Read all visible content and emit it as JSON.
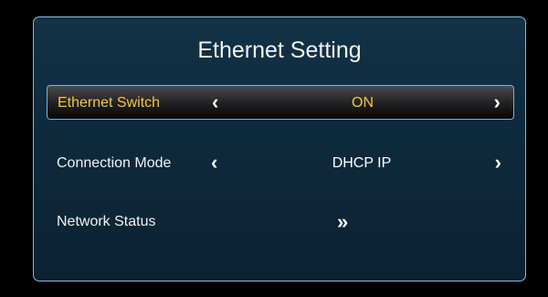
{
  "title": "Ethernet Setting",
  "rows": [
    {
      "label": "Ethernet Switch",
      "value": "ON",
      "selected": true
    },
    {
      "label": "Connection Mode",
      "value": "DHCP IP",
      "selected": false
    },
    {
      "label": "Network Status",
      "action": "enter",
      "selected": false
    }
  ],
  "icons": {
    "left": "‹",
    "right": "›",
    "enter": "»"
  },
  "colors": {
    "highlight_text": "#f5c542",
    "panel_bg": "#0e2a3d",
    "panel_border": "#8fb6d2"
  }
}
